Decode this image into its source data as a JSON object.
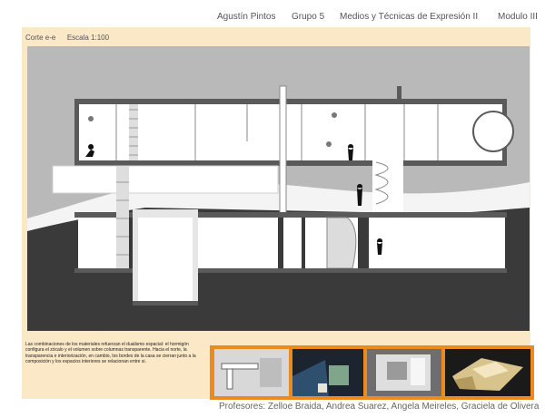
{
  "header": {
    "author": "Agustín Pintos",
    "group": "Grupo 5",
    "course": "Medios y Técnicas de Expresión II",
    "module": "Modulo III"
  },
  "section": {
    "label": "Corte e-e",
    "scale": "Escala 1:100"
  },
  "description": "Las combinaciones de los materiales refuerzan el dualismo espacial: el hormigón configura el zócalo y el volumen sobre columnas transparente. Hacia el norte, la transparencia e interiorización, en cambio, los bordes de la casa se cierran junto a la composición y los espacios interiores se relacionan entre si.",
  "thumbnails": [
    {
      "name": "plan-model-photo"
    },
    {
      "name": "interior-night-photo"
    },
    {
      "name": "model-interior-photo"
    },
    {
      "name": "model-exterior-photo"
    }
  ],
  "professors": "Profesores: Zelloe Braida, Andrea Suarez, Angela Meireles, Graciela de Olivera",
  "colors": {
    "board": "#fbe8c6",
    "frame": "#ea8a1f",
    "sky": "#b9b9b9",
    "ground": "#3a3a3a"
  }
}
